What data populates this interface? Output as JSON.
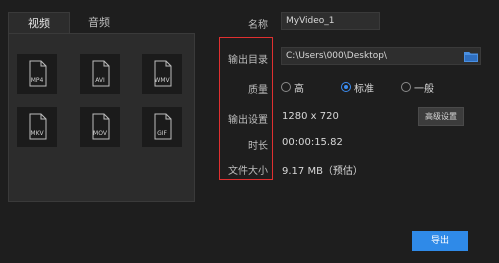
{
  "tabs": {
    "video": "视频",
    "audio": "音频"
  },
  "formats": [
    {
      "label": "MP4",
      "selected": true
    },
    {
      "label": "AVI",
      "selected": false
    },
    {
      "label": "WMV",
      "selected": false
    },
    {
      "label": "MKV",
      "selected": false
    },
    {
      "label": "MOV",
      "selected": false
    },
    {
      "label": "GIF",
      "selected": false
    }
  ],
  "form": {
    "name_label": "名称",
    "name_value": "MyVideo_1",
    "output_dir_label": "输出目录",
    "output_dir_value": "C:\\Users\\000\\Desktop\\",
    "quality_label": "质量",
    "quality_options": [
      {
        "label": "高",
        "checked": false
      },
      {
        "label": "标准",
        "checked": true
      },
      {
        "label": "一般",
        "checked": false
      }
    ],
    "output_settings_label": "输出设置",
    "output_settings_value": "1280 x 720",
    "advanced_button": "高级设置",
    "duration_label": "时长",
    "duration_value": "00:00:15.82",
    "filesize_label": "文件大小",
    "filesize_value": "9.17 MB（预估）"
  },
  "export_button": "导出",
  "colors": {
    "accent": "#2f8ae8",
    "highlight": "#e03030",
    "background": "#1e1e1e"
  },
  "icons": {
    "file": "file-icon",
    "folder": "folder-icon"
  }
}
